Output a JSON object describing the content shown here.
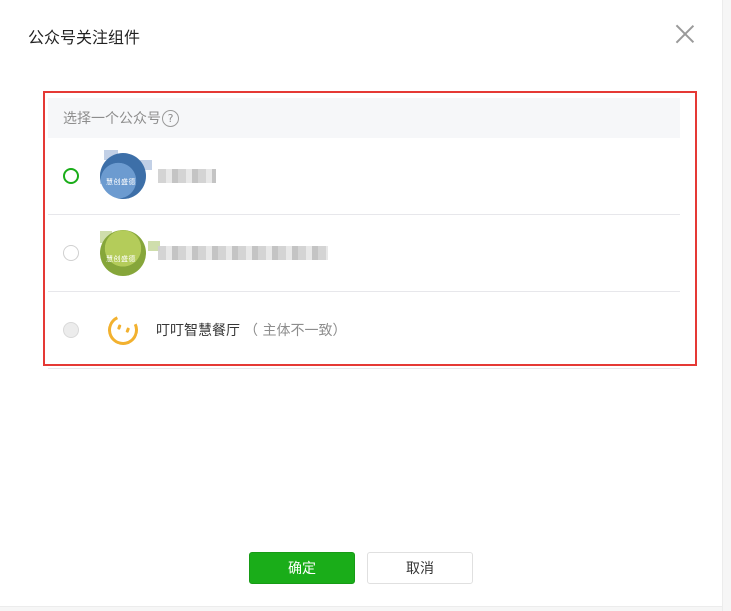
{
  "dialog": {
    "title": "公众号关注组件",
    "close_icon": "close-icon"
  },
  "panel": {
    "header_label": "选择一个公众号",
    "help_icon_glyph": "?",
    "accounts": [
      {
        "name": "",
        "note": "",
        "selected": true,
        "disabled": false,
        "avatar_caption": "慧创盛德"
      },
      {
        "name": "",
        "note": "",
        "selected": false,
        "disabled": false,
        "avatar_caption": "慧创盛德"
      },
      {
        "name": "叮叮智慧餐厅",
        "note": "（ 主体不一致）",
        "selected": false,
        "disabled": true
      }
    ]
  },
  "actions": {
    "confirm_label": "确定",
    "cancel_label": "取消"
  },
  "colors": {
    "accent_green": "#1aad19",
    "highlight_red": "#e53935"
  }
}
